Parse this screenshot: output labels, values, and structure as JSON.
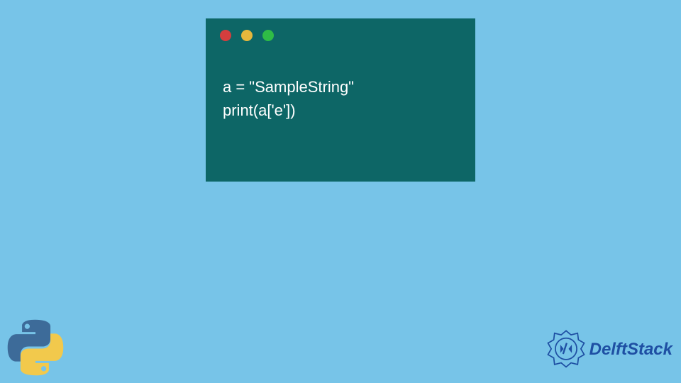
{
  "code": {
    "lines": [
      "a = \"SampleString\"",
      "print(a['e'])"
    ]
  },
  "window": {
    "dot_colors": {
      "red": "#d43e3e",
      "yellow": "#e6b73c",
      "green": "#2fbc46"
    },
    "background": "#0d6666"
  },
  "page": {
    "background": "#77c4e8"
  },
  "branding": {
    "delft_text": "DelftStack",
    "delft_color": "#1e4fa3",
    "python_icon": "python-logo"
  }
}
